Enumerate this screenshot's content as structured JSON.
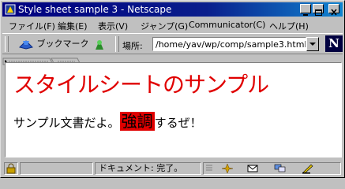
{
  "window": {
    "title": "Style sheet sample 3 - Netscape",
    "controls": [
      "minimize",
      "maximize",
      "close"
    ]
  },
  "menubar": {
    "items": [
      {
        "label": "ファイル(F)"
      },
      {
        "label": "編集(E)"
      },
      {
        "label": "表示(V)"
      },
      {
        "label": "ジャンプ(G)"
      },
      {
        "label": "Communicator(C)"
      },
      {
        "label": "ヘルプ(H)"
      }
    ]
  },
  "toolbar": {
    "bookmarks_label": "ブックマーク",
    "location_label": "場所:",
    "location_value": "/home/yav/wp/comp/sample3.html",
    "logo": "N"
  },
  "page": {
    "heading": "スタイルシートのサンプル",
    "paragraph_before": "サンプル文書だよ。",
    "emphasis": "強調",
    "paragraph_after": "するぜ！",
    "heading_color": "#e00000",
    "emphasis_bg": "#e00000"
  },
  "status": {
    "text": "ドキュメント: 完了。"
  }
}
